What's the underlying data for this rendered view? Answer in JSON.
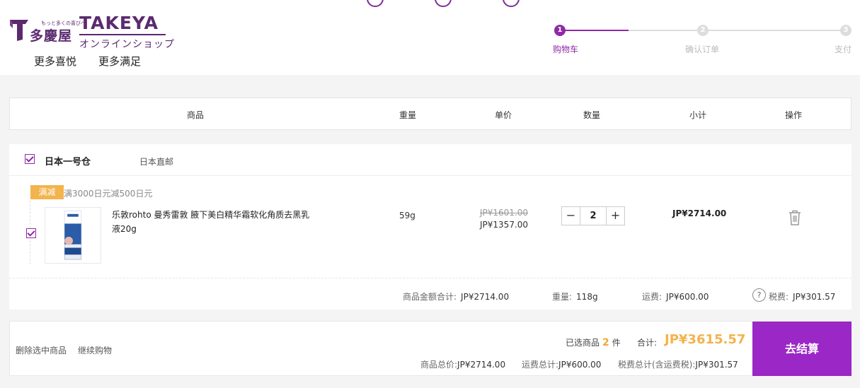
{
  "brand": {
    "name_cn": "多慶屋",
    "tagline": "もっと多くの喜びへ",
    "name_en": "TAKEYA",
    "name_jp": "オンラインショップ",
    "slogan1": "更多喜悦",
    "slogan2": "更多满足",
    "accent": "#5b2a6e"
  },
  "steps": [
    {
      "num": "1",
      "label": "购物车",
      "active": true
    },
    {
      "num": "2",
      "label": "确认订单",
      "active": false
    },
    {
      "num": "3",
      "label": "支付",
      "active": false
    }
  ],
  "table_header": {
    "product": "商品",
    "weight": "重量",
    "unit_price": "单价",
    "quantity": "数量",
    "subtotal": "小计",
    "action": "操作"
  },
  "warehouse": {
    "name": "日本一号仓",
    "type": "日本直邮",
    "promo_tag": "满减",
    "promo_text": "满3000日元减500日元"
  },
  "item": {
    "name": "乐敦rohto 曼秀雷敦 腋下美白精华霜软化角质去黑乳液20g",
    "weight": "59g",
    "original_price": "JP¥1601.00",
    "unit_price": "JP¥1357.00",
    "quantity": "2",
    "subtotal": "JP¥2714.00",
    "minus": "−",
    "plus": "+",
    "icon": "trash-icon"
  },
  "warehouse_summary": {
    "goods_total_label": "商品金额合计:",
    "goods_total": "JP¥2714.00",
    "weight_label": "重量:",
    "weight": "118g",
    "shipping_label": "运费:",
    "shipping": "JP¥600.00",
    "help": "?",
    "tax_label": "税费:",
    "tax": "JP¥301.57"
  },
  "footer": {
    "delete_selected": "删除选中商品",
    "continue_shopping": "继续购物",
    "selected_prefix": "已选商品",
    "selected_count": "2",
    "selected_unit": "件",
    "total_label": "合计:",
    "total": "JP¥3615.57",
    "goods_total_label": "商品总价:",
    "goods_total": "JP¥2714.00",
    "shipping_total_label": "运费总计:",
    "shipping_total": "JP¥600.00",
    "tax_total_label": "税费总计(含运费税):",
    "tax_total": "JP¥301.57",
    "checkout": "去结算",
    "checkout_color": "#9a27c6",
    "price_color": "#f3b34d"
  }
}
